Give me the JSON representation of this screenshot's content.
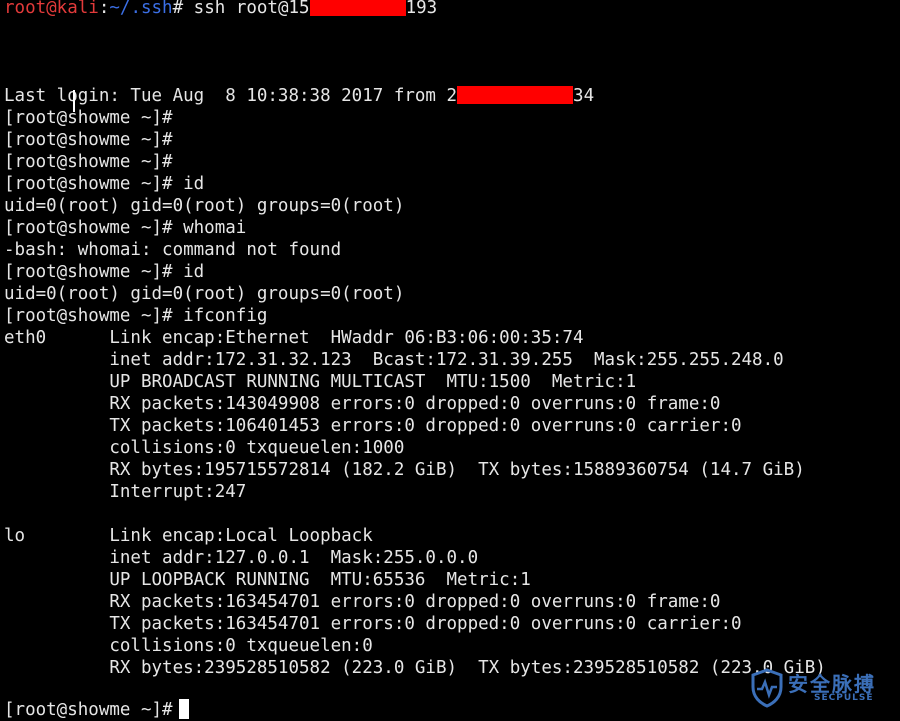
{
  "terminal": {
    "colors": {
      "background": "#000000",
      "text": "#e6e6e6",
      "prompt_user": "#e23a3a",
      "prompt_path": "#3b6fe6",
      "redaction": "#ff0000"
    },
    "local_prompt": {
      "user_host": "root@kali",
      "sep": ":",
      "path": "~/.ssh",
      "symbol": "#",
      "command_pre": " ssh root@15",
      "command_post": "193"
    },
    "last_login": {
      "pre": "Last login: Tue Aug  8 10:38:38 2017 from 2",
      "post": "34"
    },
    "lines": {
      "p1": "[root@showme ~]#",
      "p2": "[root@showme ~]#",
      "p3": "[root@showme ~]#",
      "p4": "[root@showme ~]# id",
      "o1": "uid=0(root) gid=0(root) groups=0(root)",
      "p5": "[root@showme ~]# whomai",
      "o2": "-bash: whomai: command not found",
      "p6": "[root@showme ~]# id",
      "o3": "uid=0(root) gid=0(root) groups=0(root)",
      "p7": "[root@showme ~]# ifconfig",
      "e1": "eth0      Link encap:Ethernet  HWaddr 06:B3:06:00:35:74",
      "e2": "          inet addr:172.31.32.123  Bcast:172.31.39.255  Mask:255.255.248.0",
      "e3": "          UP BROADCAST RUNNING MULTICAST  MTU:1500  Metric:1",
      "e4": "          RX packets:143049908 errors:0 dropped:0 overruns:0 frame:0",
      "e5": "          TX packets:106401453 errors:0 dropped:0 overruns:0 carrier:0",
      "e6": "          collisions:0 txqueuelen:1000",
      "e7": "          RX bytes:195715572814 (182.2 GiB)  TX bytes:15889360754 (14.7 GiB)",
      "e8": "          Interrupt:247",
      "l1": "lo        Link encap:Local Loopback",
      "l2": "          inet addr:127.0.0.1  Mask:255.0.0.0",
      "l3": "          UP LOOPBACK RUNNING  MTU:65536  Metric:1",
      "l4": "          RX packets:163454701 errors:0 dropped:0 overruns:0 frame:0",
      "l5": "          TX packets:163454701 errors:0 dropped:0 overruns:0 carrier:0",
      "l6": "          collisions:0 txqueuelen:0",
      "l7": "          RX bytes:239528510582 (223.0 GiB)  TX bytes:239528510582 (223.0 GiB)",
      "final_prompt": "[root@showme ~]#"
    }
  },
  "watermark": {
    "title": "安全脉搏",
    "subtitle": "SECPULSE",
    "icon": "shield-pulse-icon",
    "color": "#3b6fb8"
  }
}
